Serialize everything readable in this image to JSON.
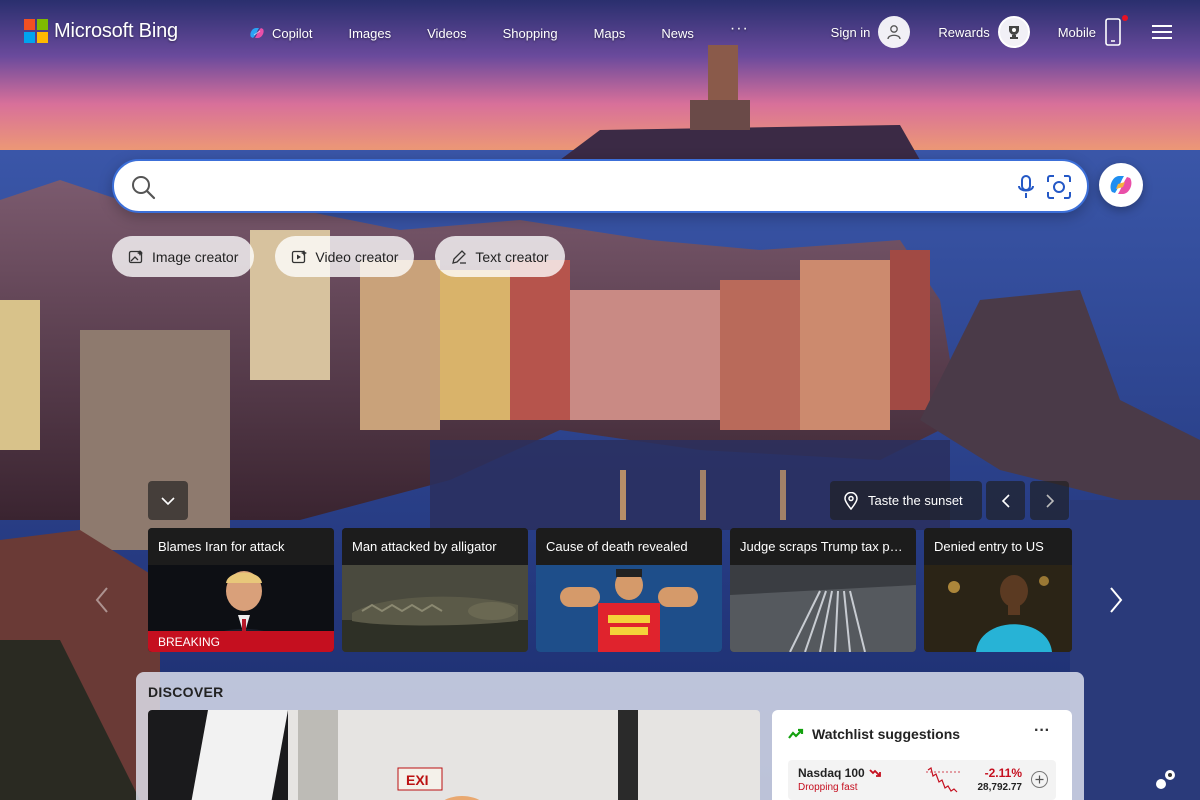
{
  "brand": {
    "name": "Microsoft Bing",
    "logo_colors": [
      "#f25022",
      "#7fba00",
      "#00a4ef",
      "#ffb900"
    ]
  },
  "nav": {
    "items": [
      {
        "label": "Copilot",
        "icon": "copilot-icon"
      },
      {
        "label": "Images"
      },
      {
        "label": "Videos"
      },
      {
        "label": "Shopping"
      },
      {
        "label": "Maps"
      },
      {
        "label": "News"
      }
    ],
    "more_label": "···"
  },
  "header_right": {
    "sign_in": "Sign in",
    "rewards": "Rewards",
    "mobile": "Mobile"
  },
  "search": {
    "value": "",
    "placeholder": "",
    "accent": "#3c6fd8"
  },
  "chips": [
    {
      "label": "Image creator",
      "icon": "image-creator-icon"
    },
    {
      "label": "Video creator",
      "icon": "video-creator-icon"
    },
    {
      "label": "Text creator",
      "icon": "text-creator-icon"
    }
  ],
  "carousel": {
    "location_label": "Taste the sunset",
    "cards": [
      {
        "title": "Blames Iran for attack",
        "badge": "BREAKING"
      },
      {
        "title": "Man attacked by alligator"
      },
      {
        "title": "Cause of death revealed"
      },
      {
        "title": "Judge scraps Trump tax po..."
      },
      {
        "title": "Denied entry to US"
      }
    ]
  },
  "discover": {
    "label": "DISCOVER",
    "hero_sign": "EXI",
    "watchlist": {
      "title": "Watchlist suggestions",
      "more": "···",
      "rows": [
        {
          "name": "Nasdaq 100",
          "status": "Dropping fast",
          "change": "-2.11%",
          "value": "28,792.77"
        }
      ]
    }
  },
  "colors": {
    "breaking": "#c50f1f",
    "negative": "#c50f1f",
    "positive": "#13a10e"
  }
}
